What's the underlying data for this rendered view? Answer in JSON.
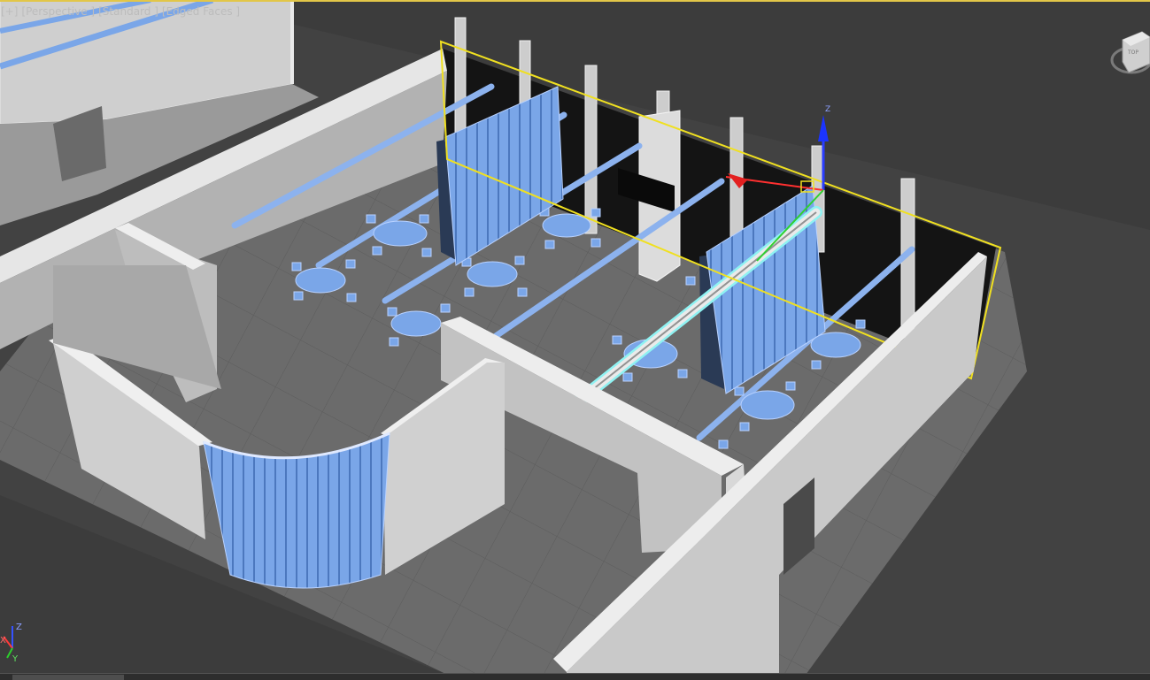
{
  "viewport": {
    "menu": "[+]",
    "view": "[Perspective ]",
    "shading": "[Standard ]",
    "faces": "[Edged Faces ]"
  },
  "viewcube": {
    "face_label": "TOP",
    "icon": "viewcube-icon"
  },
  "axis_tripod": {
    "x": "X",
    "y": "Y",
    "z": "Z"
  },
  "gizmo": {
    "z_label": "Z",
    "icon": "move-gizmo-icon"
  },
  "colors": {
    "viewport_bg": "#3c3c3c",
    "selection_box": "#f0e020",
    "object_blue": "#7aa6e8",
    "highlight_cyan": "#8ff2f2",
    "active_border": "#e2c648"
  }
}
